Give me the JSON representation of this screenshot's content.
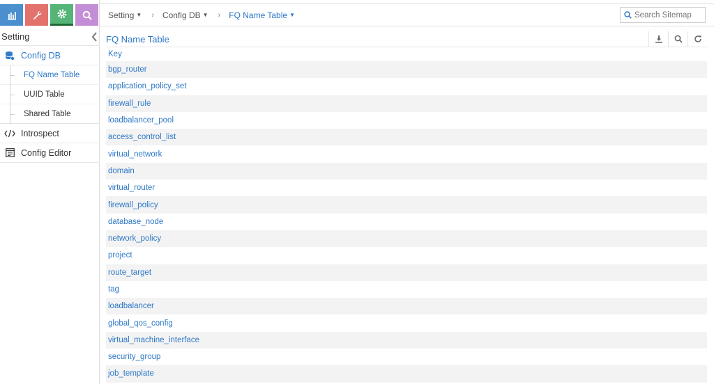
{
  "sidebar": {
    "app_tabs": [
      {
        "name": "monitor",
        "icon": "bar-chart-icon",
        "color": "#4b8fcf"
      },
      {
        "name": "configure",
        "icon": "wrench-icon",
        "color": "#e2726b"
      },
      {
        "name": "setting",
        "icon": "gear-icon",
        "color": "#55b577"
      },
      {
        "name": "query",
        "icon": "magnifier-icon",
        "color": "#c48ed6"
      }
    ],
    "header": "Setting",
    "items": [
      {
        "label": "Config DB",
        "icon": "database-icon",
        "active": true
      },
      {
        "label": "FQ Name Table",
        "active": true
      },
      {
        "label": "UUID Table"
      },
      {
        "label": "Shared Table"
      },
      {
        "label": "Introspect",
        "icon": "code-icon"
      },
      {
        "label": "Config Editor",
        "icon": "editor-icon"
      }
    ]
  },
  "breadcrumb": {
    "items": [
      "Setting",
      "Config DB",
      "FQ Name Table"
    ]
  },
  "search": {
    "placeholder": "Search Sitemap"
  },
  "main": {
    "title": "FQ Name Table",
    "tools": [
      "download-icon",
      "search-icon",
      "refresh-icon"
    ],
    "column_header": "Key",
    "rows": [
      "bgp_router",
      "application_policy_set",
      "firewall_rule",
      "loadbalancer_pool",
      "access_control_list",
      "virtual_network",
      "domain",
      "virtual_router",
      "firewall_policy",
      "database_node",
      "network_policy",
      "project",
      "route_target",
      "tag",
      "loadbalancer",
      "global_qos_config",
      "virtual_machine_interface",
      "security_group",
      "job_template"
    ]
  },
  "colors": {
    "link": "#2e78c7",
    "row_alt": "#f3f3f3"
  }
}
